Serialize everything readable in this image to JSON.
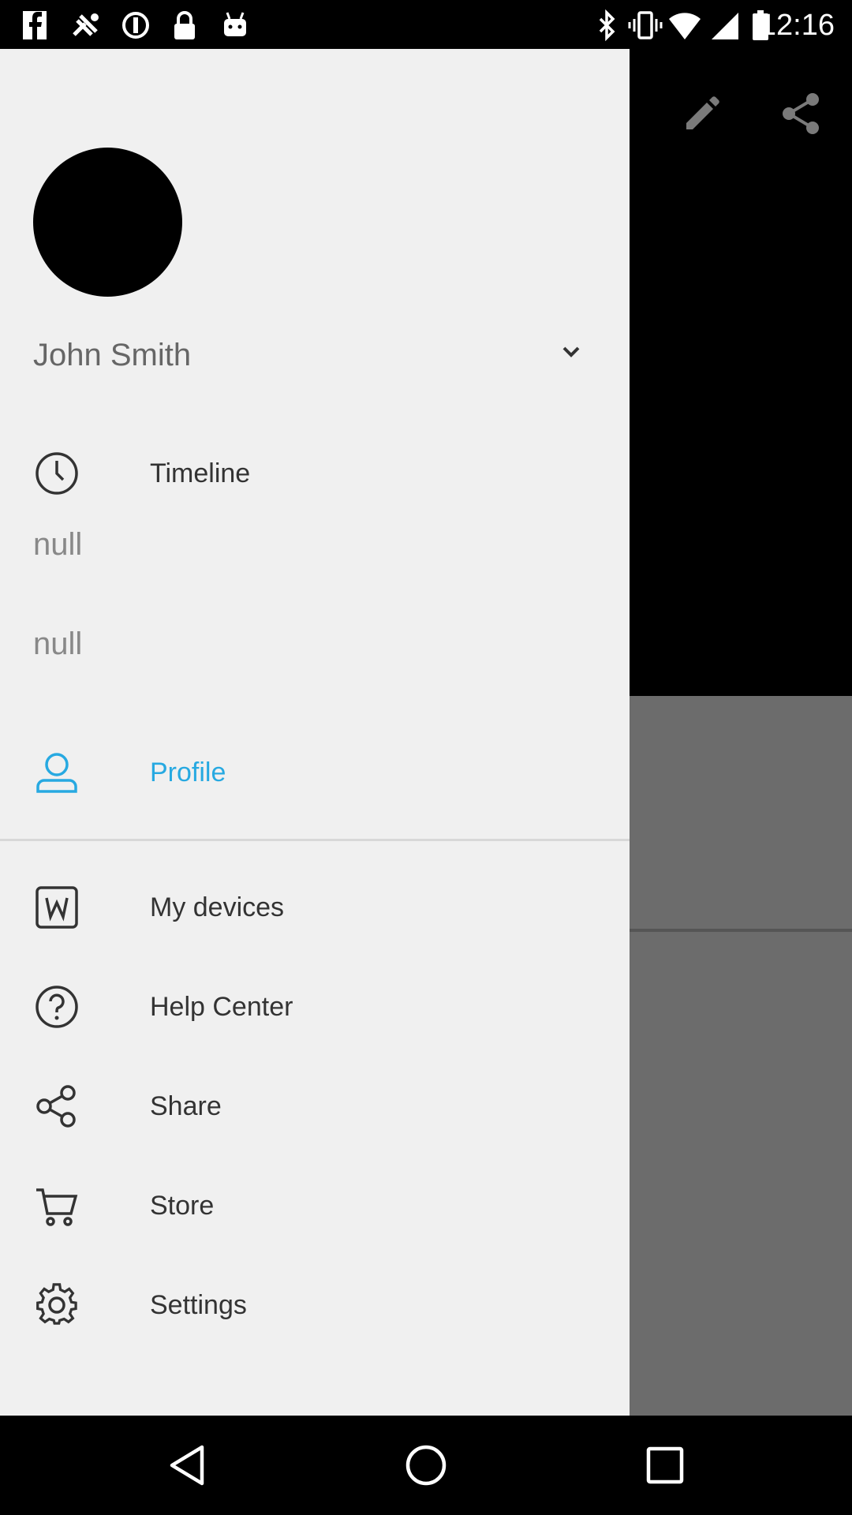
{
  "status_bar": {
    "time": "12:16",
    "left_icons": [
      "facebook-icon",
      "fake-gps-icon",
      "sync-icon",
      "lock-icon",
      "android-icon"
    ],
    "right_icons": [
      "bluetooth-icon",
      "vibrate-icon",
      "wifi-icon",
      "signal-icon",
      "battery-icon"
    ]
  },
  "background_toolbar": {
    "edit_icon": "pencil-icon",
    "share_icon": "share-icon"
  },
  "drawer": {
    "user_name": "John Smith",
    "items": [
      {
        "label": "Timeline",
        "icon": "clock-icon"
      },
      {
        "label": "Profile",
        "icon": "person-icon",
        "active": true
      },
      {
        "label": "My devices",
        "icon": "watch-w-icon"
      },
      {
        "label": "Help Center",
        "icon": "help-icon"
      },
      {
        "label": "Share",
        "icon": "share-icon"
      },
      {
        "label": "Store",
        "icon": "cart-icon"
      },
      {
        "label": "Settings",
        "icon": "gear-icon"
      }
    ],
    "null_1": "null",
    "null_2": "null"
  },
  "colors": {
    "accent": "#27a9e1",
    "drawer_bg": "#f0f0f0",
    "scrim_bottom": "#6c6c6c"
  }
}
